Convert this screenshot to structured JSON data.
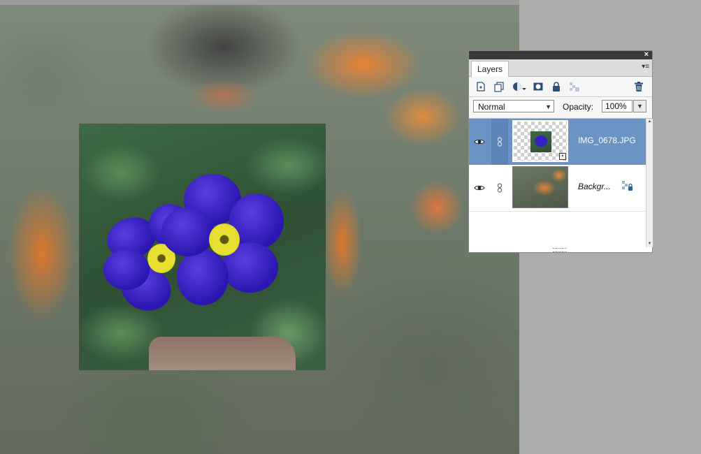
{
  "panel": {
    "tab_label": "Layers",
    "close_glyph": "×",
    "menu_glyph": "▾≡",
    "toolbar_icons": [
      "new-layer-icon",
      "duplicate-layer-icon",
      "adjustment-layer-icon",
      "layer-mask-icon",
      "lock-all-icon",
      "lock-transparent-icon",
      "delete-layer-icon"
    ]
  },
  "controls": {
    "blend_mode": "Normal",
    "opacity_label": "Opacity:",
    "opacity_value": "100%"
  },
  "layers": [
    {
      "name": "IMG_0678.JPG",
      "selected": true,
      "visible": true
    },
    {
      "name": "Backgr...",
      "selected": false,
      "visible": true,
      "locked": true
    }
  ],
  "colors": {
    "selected_row": "#6b93c4",
    "panel_title": "#3a3a3a",
    "workspace": "#aeaeae"
  }
}
